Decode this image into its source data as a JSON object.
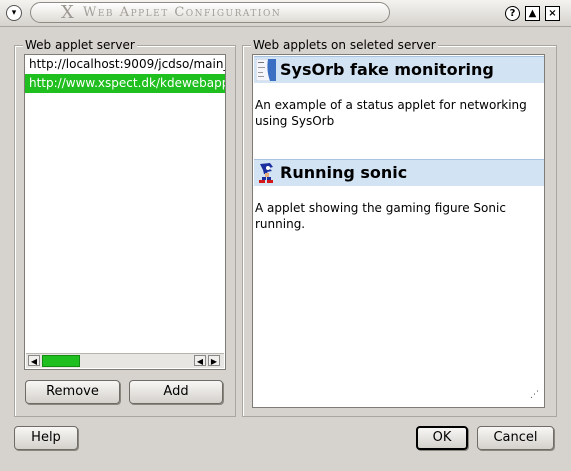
{
  "window": {
    "title": "Web Applet Configuration",
    "logo": "X",
    "buttons": {
      "menu": "▾",
      "help": "?",
      "shade": "▲",
      "close": "×"
    }
  },
  "left_panel": {
    "label": "Web applet server",
    "servers": [
      "http://localhost:9009/jcdso/main_",
      "http://www.xspect.dk/kdewebapp"
    ],
    "selected_index": 1,
    "remove_label": "Remove",
    "add_label": "Add"
  },
  "right_panel": {
    "label": "Web applets on seleted server",
    "applets": [
      {
        "name": "SysOrb fake monitoring",
        "description": "An example of a status applet for networking using SysOrb",
        "icon": "sysorb-thumbnail-icon"
      },
      {
        "name": "Running sonic",
        "description": "A applet showing the gaming figure Sonic running.",
        "icon": "sonic-sprite-icon"
      }
    ]
  },
  "footer": {
    "help_label": "Help",
    "ok_label": "OK",
    "cancel_label": "Cancel"
  },
  "colors": {
    "selection": "#1fbf1f",
    "applet_header": "#d2e3f4",
    "window_bg": "#d6d3ce"
  }
}
